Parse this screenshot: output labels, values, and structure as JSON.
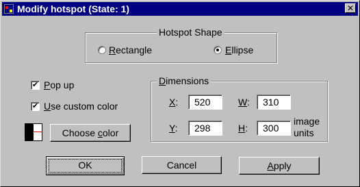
{
  "window": {
    "title": "Modify hotspot (State: 1)",
    "close_glyph": "✕"
  },
  "hotspot_shape": {
    "legend": "Hotspot Shape",
    "options": [
      {
        "label_first": "R",
        "label_rest": "ectangle",
        "selected": false
      },
      {
        "label_first": "E",
        "label_rest": "llipse",
        "selected": true
      }
    ]
  },
  "options": {
    "popup": {
      "label_first": "P",
      "label_rest": "op up",
      "checked": true
    },
    "custom_color": {
      "label_first": "U",
      "label_rest": "se custom color",
      "checked": true
    },
    "check_glyph": "✔"
  },
  "color": {
    "choose_label_pre": "Choose ",
    "choose_label_u": "c",
    "choose_label_post": "olor",
    "swatch_colors": {
      "fill": "#000000",
      "background": "#ffffff",
      "line": "#e00000"
    }
  },
  "dimensions": {
    "legend_first": "D",
    "legend_rest": "imensions",
    "x": {
      "label_u": "X",
      "label_colon": ":",
      "value": "520"
    },
    "y": {
      "label_u": "Y",
      "label_colon": ":",
      "value": "298"
    },
    "w": {
      "label_u": "W",
      "label_colon": ":",
      "value": "310"
    },
    "h": {
      "label_u": "H",
      "label_colon": ":",
      "value": "300"
    },
    "units_line1": "image",
    "units_line2": "units"
  },
  "buttons": {
    "ok": "OK",
    "cancel": "Cancel",
    "apply_u": "A",
    "apply_rest": "pply"
  },
  "colors": {
    "titlebar": "#000080",
    "face": "#c0c0c0"
  }
}
